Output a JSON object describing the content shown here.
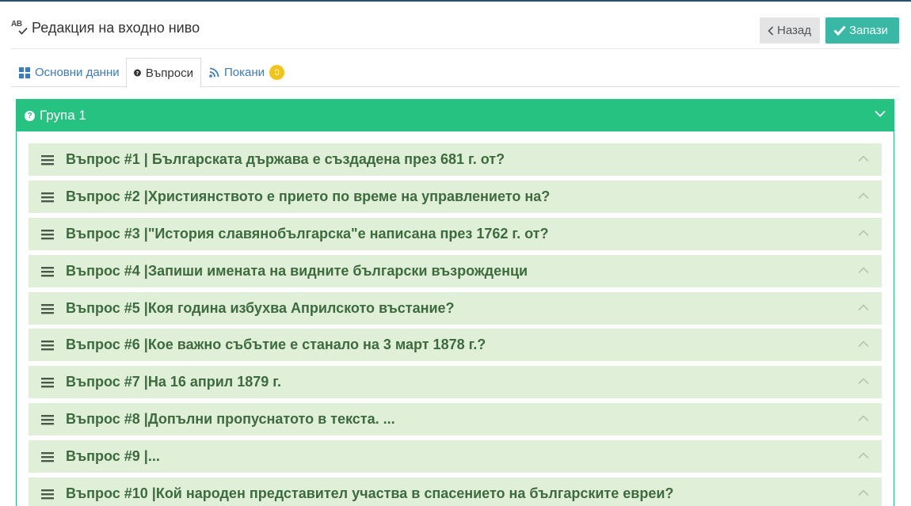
{
  "header": {
    "title": "Редакция на входно ниво",
    "title_icon": "spell-check-icon",
    "back_label": "Назад",
    "save_label": "Запази"
  },
  "tabs": [
    {
      "label": "Основни данни",
      "icon": "grid-icon",
      "active": false
    },
    {
      "label": "Въпроси",
      "icon": "question-circle-icon",
      "active": true
    },
    {
      "label": "Покани",
      "icon": "rss-icon",
      "active": false,
      "badge": "0"
    }
  ],
  "group": {
    "title": "Група 1",
    "color": "#26c281"
  },
  "questions": [
    {
      "text": "Въпрос #1 | Българската държава е създадена през 681 г. от?"
    },
    {
      "text": "Въпрос #2 |Християнството е прието по време на управлението на?"
    },
    {
      "text": "Въпрос #3 |\"История славянобългарска\"е написана през 1762 г. от?"
    },
    {
      "text": "Въпрос #4 |Запиши имената на видните български възрожденци"
    },
    {
      "text": "Въпрос #5 |Коя година избухва Априлското въстание?"
    },
    {
      "text": "Въпрос #6 |Кое важно събътие е станало на 3 март 1878 г.?"
    },
    {
      "text": "Въпрос #7 |На 16 април 1879 г."
    },
    {
      "text": "Въпрос #8 |Допълни пропуснатото в текста. ..."
    },
    {
      "text": "Въпрос #9 |..."
    },
    {
      "text": "Въпрос #10 |Кой народен представител участва в спасението на българските евреи?"
    }
  ],
  "colors": {
    "accent_green": "#26c281",
    "save_button": "#39b8a6",
    "question_row_bg": "#dfefd8",
    "question_text": "#3d6b3d",
    "link_blue": "#3a7cc4",
    "badge_yellow": "#f0c419"
  }
}
